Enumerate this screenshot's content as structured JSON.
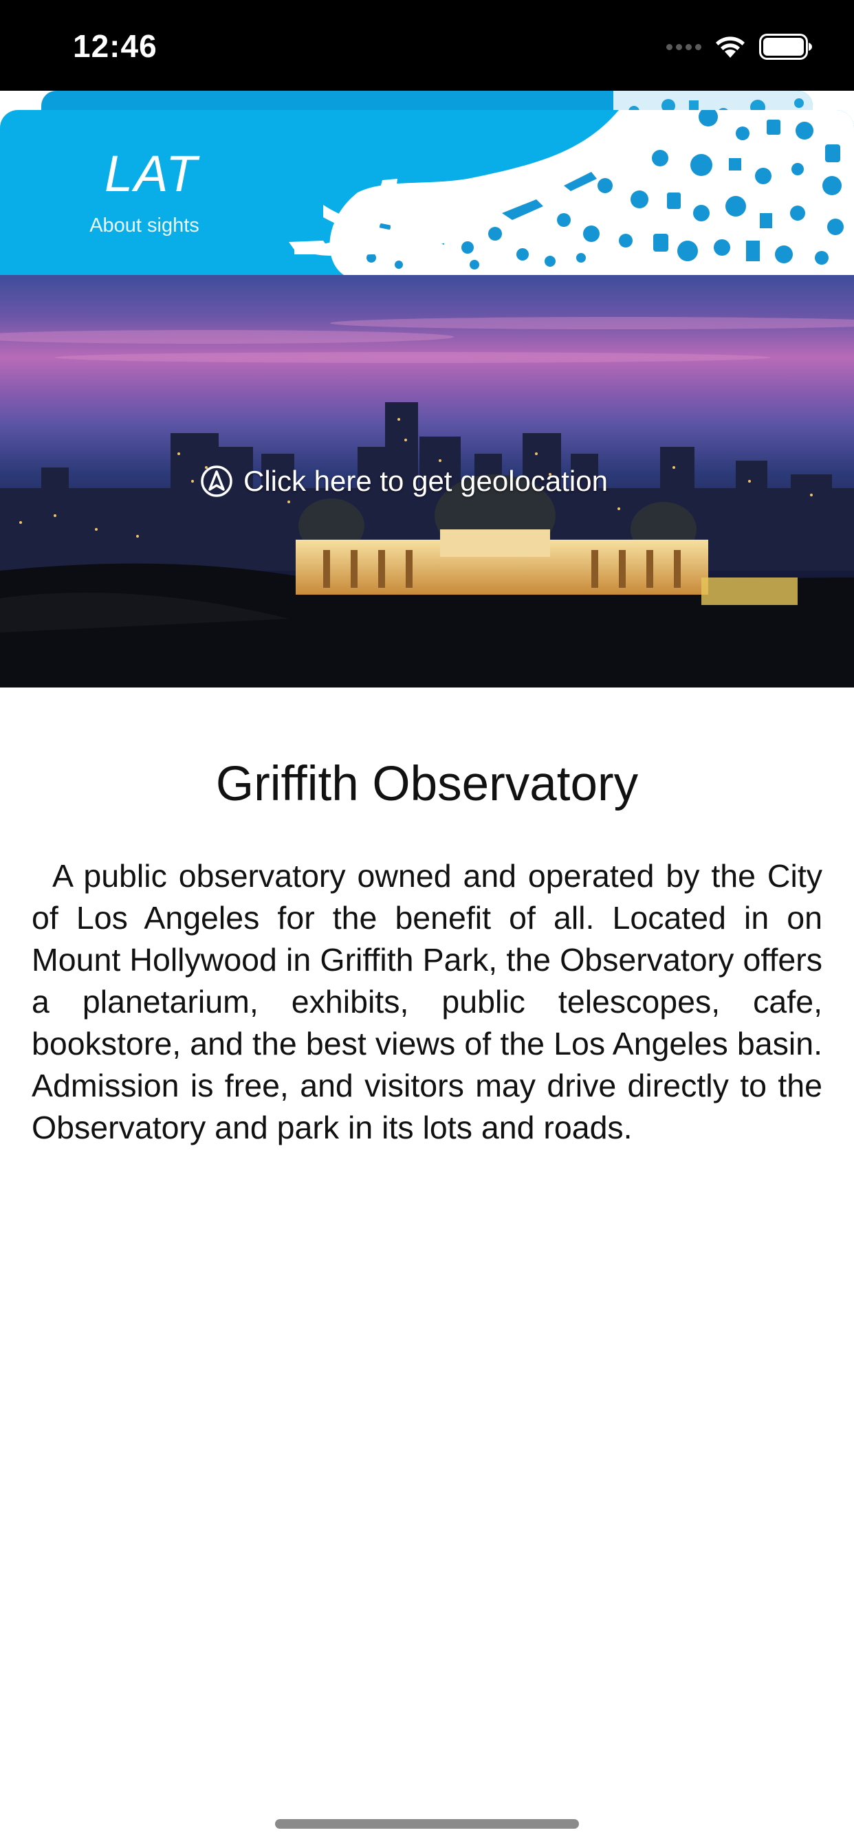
{
  "status_bar": {
    "time": "12:46",
    "icons": [
      "cellular-dots-icon",
      "wifi-icon",
      "battery-icon"
    ]
  },
  "header": {
    "title": "LAT",
    "subtitle": "About sights",
    "decoration": [
      "airplane-icon",
      "travel-pattern"
    ],
    "color": "#09aee9"
  },
  "hero": {
    "image": "Los Angeles skyline at dusk with Griffith Observatory",
    "geolocation_button": {
      "icon": "location-arrow-icon",
      "label": "Click here to get geolocation"
    }
  },
  "sight": {
    "title": "Griffith Observatory",
    "description": "A public observatory owned and operated by the City of Los Angeles for the benefit of all. Located in on Mount Hollywood in Griffith Park, the Observatory offers a planetarium, exhibits, public telescopes, cafe, bookstore, and the best views of the Los Angeles basin. Admission is free, and visitors may drive directly to the Observatory and park in its lots and roads."
  }
}
